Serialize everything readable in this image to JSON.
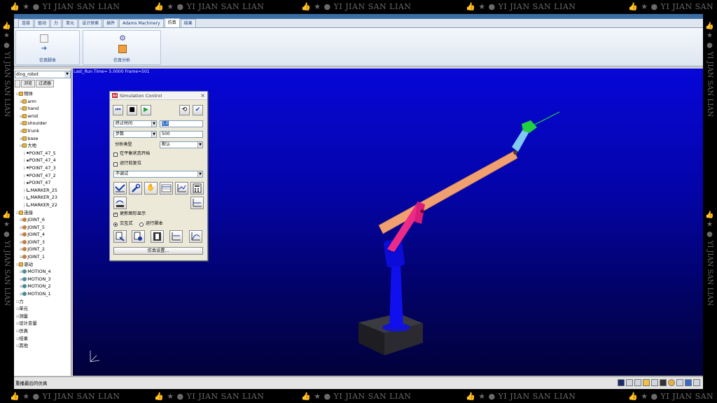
{
  "watermark": {
    "text": "YI JIAN SAN LIAN",
    "icon_names": [
      "thumb-up-icon",
      "star-icon",
      "coin-icon"
    ]
  },
  "ribbon": {
    "tabs": [
      {
        "label": "连接"
      },
      {
        "label": "驱动"
      },
      {
        "label": "力"
      },
      {
        "label": "单元"
      },
      {
        "label": "设计探索"
      },
      {
        "label": "插件"
      },
      {
        "label": "Adams Machinery"
      },
      {
        "label": "仿真",
        "active": true
      },
      {
        "label": "结果"
      }
    ],
    "groups": [
      {
        "caption": "仿真脚本"
      },
      {
        "caption": "仿真分析"
      }
    ]
  },
  "model_browser": {
    "model_name": "ding_robot",
    "tabs": [
      "",
      "浏览",
      "过滤器"
    ],
    "tree": [
      {
        "label": "物体",
        "icon": "folder",
        "indent": 0
      },
      {
        "label": "arm",
        "icon": "part",
        "indent": 1
      },
      {
        "label": "hand",
        "icon": "part",
        "indent": 1
      },
      {
        "label": "wrist",
        "icon": "part",
        "indent": 1
      },
      {
        "label": "shoulder",
        "icon": "part",
        "indent": 1
      },
      {
        "label": "trunk",
        "icon": "part",
        "indent": 1
      },
      {
        "label": "base",
        "icon": "part",
        "indent": 1
      },
      {
        "label": "大地",
        "icon": "part",
        "indent": 1
      },
      {
        "label": "POINT_47_5",
        "icon": "point",
        "indent": 2
      },
      {
        "label": "POINT_47_4",
        "icon": "point",
        "indent": 2
      },
      {
        "label": "POINT_47_3",
        "icon": "point",
        "indent": 2
      },
      {
        "label": "POINT_47_2",
        "icon": "point",
        "indent": 2
      },
      {
        "label": "POINT_47",
        "icon": "point",
        "indent": 2
      },
      {
        "label": "MARKER_25",
        "icon": "marker",
        "indent": 2
      },
      {
        "label": "MARKER_23",
        "icon": "marker",
        "indent": 2
      },
      {
        "label": "MARKER_22",
        "icon": "marker",
        "indent": 2
      },
      {
        "label": "连接",
        "icon": "folder",
        "indent": 0
      },
      {
        "label": "JOINT_6",
        "icon": "joint",
        "indent": 1
      },
      {
        "label": "JOINT_5",
        "icon": "joint",
        "indent": 1
      },
      {
        "label": "JOINT_4",
        "icon": "joint",
        "indent": 1
      },
      {
        "label": "JOINT_3",
        "icon": "joint",
        "indent": 1
      },
      {
        "label": "JOINT_2",
        "icon": "joint",
        "indent": 1
      },
      {
        "label": "JOINT_1",
        "icon": "joint",
        "indent": 1
      },
      {
        "label": "驱动",
        "icon": "folder",
        "indent": 0
      },
      {
        "label": "MOTION_4",
        "icon": "motion",
        "indent": 1
      },
      {
        "label": "MOTION_3",
        "icon": "motion",
        "indent": 1
      },
      {
        "label": "MOTION_2",
        "icon": "motion",
        "indent": 1
      },
      {
        "label": "MOTION_1",
        "icon": "motion",
        "indent": 1
      },
      {
        "label": "力",
        "icon": "none",
        "indent": 0
      },
      {
        "label": "单元",
        "icon": "none",
        "indent": 0
      },
      {
        "label": "测量",
        "icon": "none",
        "indent": 0
      },
      {
        "label": "设计变量",
        "icon": "none",
        "indent": 0
      },
      {
        "label": "仿真",
        "icon": "none",
        "indent": 0
      },
      {
        "label": "结果",
        "icon": "none",
        "indent": 0
      },
      {
        "label": "其他",
        "icon": "none",
        "indent": 0
      }
    ]
  },
  "viewport": {
    "info": "Last_Run   Time= 5.0000  Frame=501",
    "background_top": "#0707d8",
    "background_bottom": "#01013a"
  },
  "sim_control": {
    "title": "Simulation Control",
    "logo_text": "Ad",
    "end_mode": "终止时间",
    "end_value": "5.0",
    "steps_mode": "步数",
    "steps_value": "500",
    "analysis_type_label": "分析类型",
    "analysis_type_value": "默认",
    "start_equilibrium_label": "在平衡状态开始",
    "reset_before_run_label": "运行前复位",
    "debug_value": "不调试",
    "update_graphics_label": "更新图形显示",
    "mode_interactive_label": "交互式",
    "mode_script_label": "运行脚本",
    "settings_button": "仿真设置..."
  },
  "statusbar": {
    "text": "重播最后的仿真"
  },
  "colors": {
    "upper_arm": "#f0a070",
    "forearm_link": "#ee2a88",
    "trunk": "#1010ee",
    "wrist": "#80c8f0",
    "gripper": "#20d040",
    "base": "#2a2a30"
  }
}
